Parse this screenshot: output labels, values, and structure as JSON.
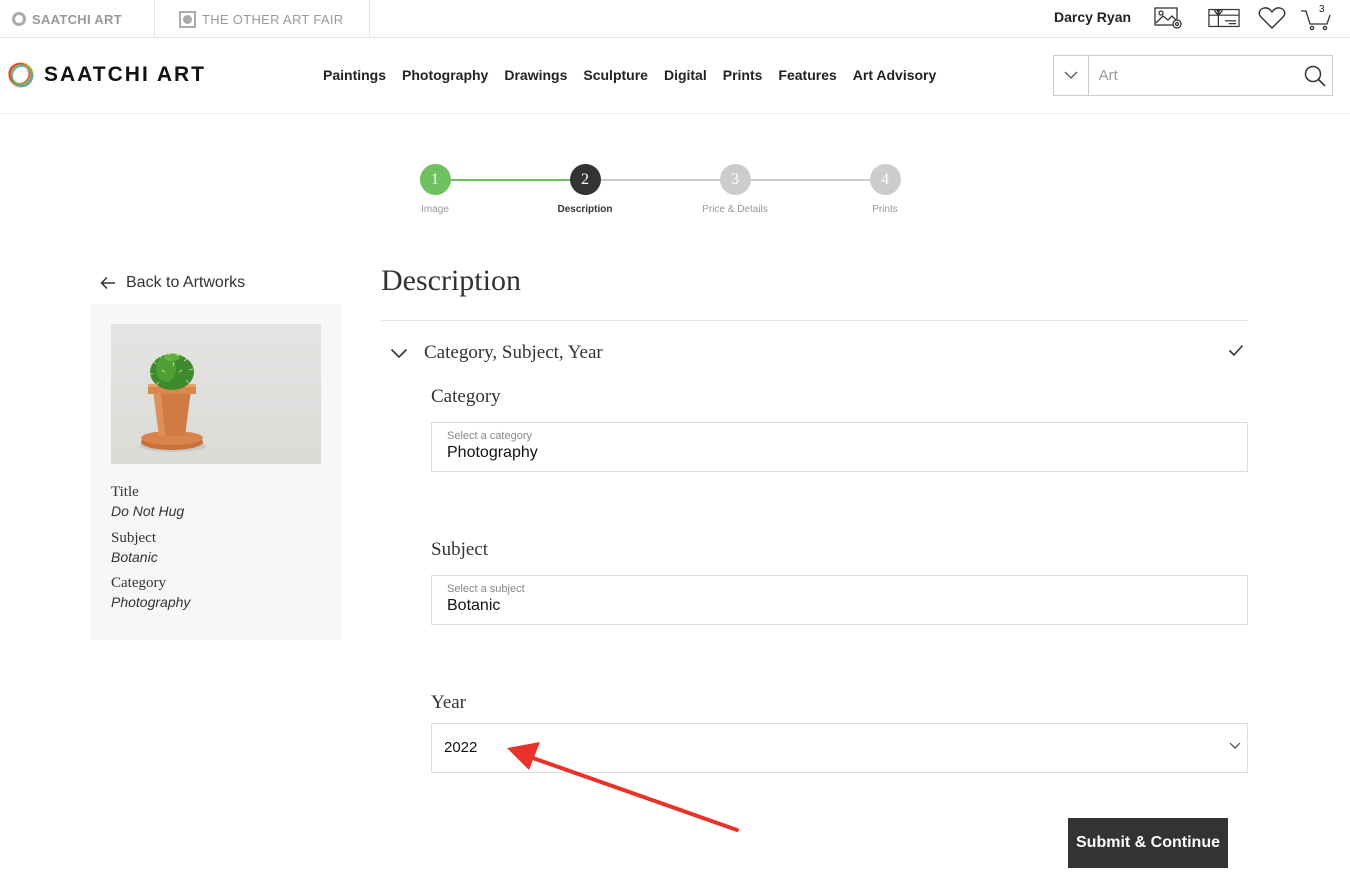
{
  "utility_bar": {
    "saatchi_label": "SAATCHI ART",
    "other_fair_label": "THE OTHER ART FAIR",
    "user_name": "Darcy Ryan",
    "cart_count": "3"
  },
  "header": {
    "logo_text": "SAATCHI ART",
    "nav": [
      "Paintings",
      "Photography",
      "Drawings",
      "Sculpture",
      "Digital",
      "Prints",
      "Features",
      "Art Advisory"
    ],
    "search_placeholder": "Art",
    "search_value": ""
  },
  "stepper": {
    "current": 2,
    "steps": [
      {
        "number": "1",
        "label": "Image",
        "state": "done"
      },
      {
        "number": "2",
        "label": "Description",
        "state": "active"
      },
      {
        "number": "3",
        "label": "Price & Details",
        "state": "upcoming"
      },
      {
        "number": "4",
        "label": "Prints",
        "state": "upcoming"
      }
    ]
  },
  "sidebar": {
    "back_label": "Back to Artworks",
    "artwork": {
      "title_label": "Title",
      "title_value": "Do Not Hug",
      "subject_label": "Subject",
      "subject_value": "Botanic",
      "category_label": "Category",
      "category_value": "Photography"
    }
  },
  "form": {
    "title": "Description",
    "section_title": "Category, Subject, Year",
    "category_label": "Category",
    "category_hint": "Select a category",
    "category_value": "Photography",
    "subject_label": "Subject",
    "subject_hint": "Select a subject",
    "subject_value": "Botanic",
    "year_label": "Year",
    "year_value": "2022",
    "submit_label": "Submit & Continue"
  },
  "colors": {
    "step_done": "#6fc05f",
    "step_active": "#333333",
    "step_upcoming": "#cccccc",
    "annotation_arrow": "#e8322a",
    "submit_bg": "#333333"
  }
}
